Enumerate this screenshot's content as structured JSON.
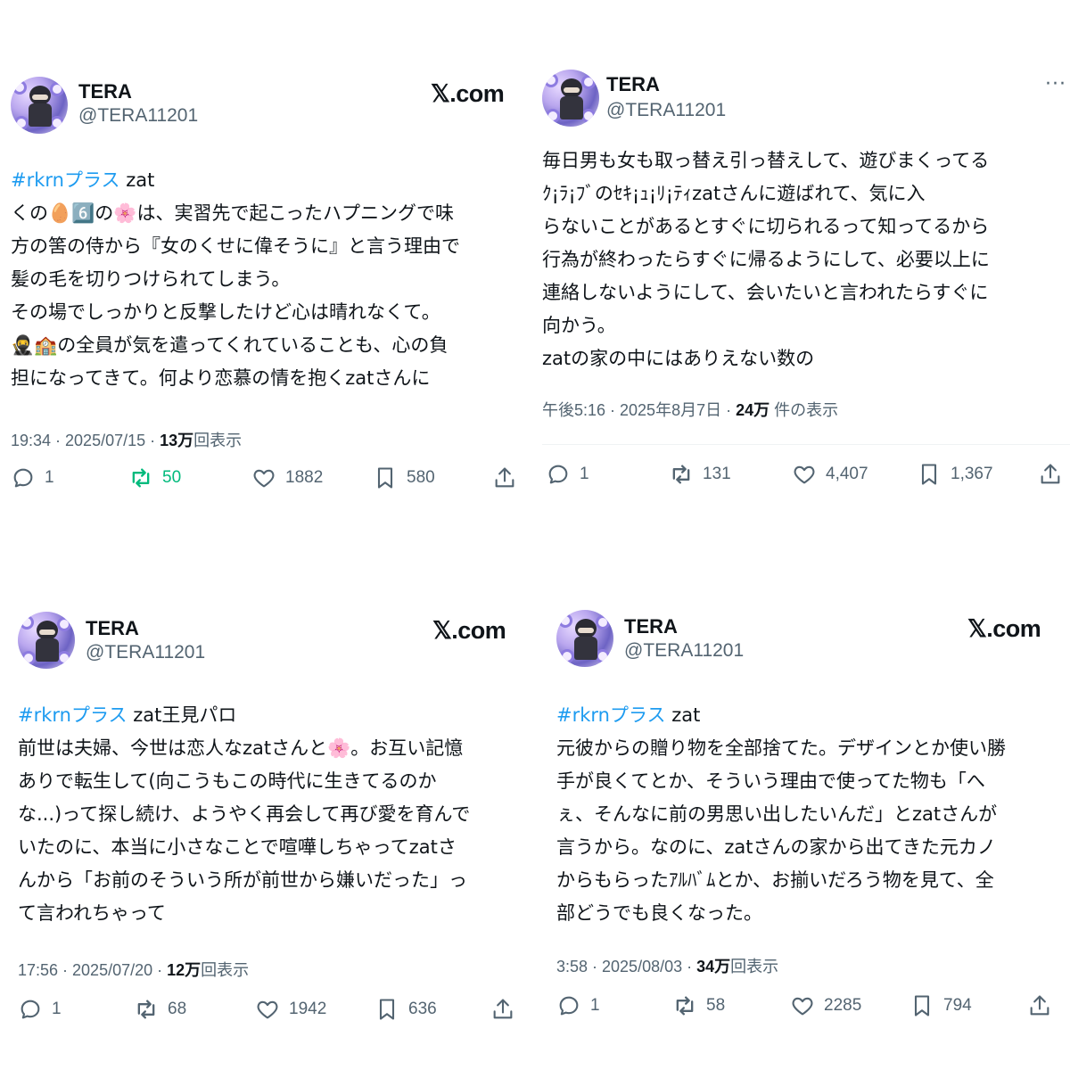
{
  "brand": {
    "x_logo": "𝕏.com",
    "retweet_active_color": "#00ba7c",
    "hashtag_color": "#1d9bf0"
  },
  "tweets": [
    {
      "name": "TERA",
      "handle": "@TERA11201",
      "hashtag": "#rkrnプラス",
      "tag_suffix": " zat",
      "lines": [
        "くの🥚6️⃣の🌸は、実習先で起こったハプニングで味",
        "方の筈の侍から『女のくせに偉そうに』と言う理由で",
        "髪の毛を切りつけられてしまう。",
        "その場でしっかりと反撃したけど心は晴れなくて。",
        "🥷🏫の全員が気を遣ってくれていることも、心の負",
        "担になってきて。何より恋慕の情を抱くzatさんに"
      ],
      "time": "19:34 · 2025/07/15 · ",
      "views": "13万",
      "views_suffix": "回表示",
      "replies": "1",
      "retweets": "50",
      "likes": "1882",
      "bookmarks": "580"
    },
    {
      "name": "TERA",
      "handle": "@TERA11201",
      "more": "···",
      "lines": [
        "毎日男も女も取っ替え引っ替えして、遊びまくってる",
        "ｸ¡ﾗ¡ﾌﾞのｾｷ¡ｭ¡ﾘ¡ﾃｨzatさんに遊ばれて、気に入",
        "らないことがあるとすぐに切られるって知ってるから",
        "行為が終わったらすぐに帰るようにして、必要以上に",
        "連絡しないようにして、会いたいと言われたらすぐに",
        "向かう。",
        "zatの家の中にはありえない数の"
      ],
      "time": "午後5:16 · 2025年8月7日 · ",
      "views": "24万",
      "views_suffix": " 件の表示",
      "replies": "1",
      "retweets": "131",
      "likes": "4,407",
      "bookmarks": "1,367"
    },
    {
      "name": "TERA",
      "handle": "@TERA11201",
      "hashtag": "#rkrnプラス",
      "tag_suffix": " zat王見パロ",
      "lines": [
        "前世は夫婦、今世は恋人なzatさんと🌸。お互い記憶",
        "ありで転生して(向こうもこの時代に生きてるのか",
        "な...)って探し続け、ようやく再会して再び愛を育んで",
        "いたのに、本当に小さなことで喧嘩しちゃってzatさ",
        "んから「お前のそういう所が前世から嫌いだった」っ",
        "て言われちゃって"
      ],
      "time": "17:56 · 2025/07/20 · ",
      "views": "12万",
      "views_suffix": "回表示",
      "replies": "1",
      "retweets": "68",
      "likes": "1942",
      "bookmarks": "636"
    },
    {
      "name": "TERA",
      "handle": "@TERA11201",
      "hashtag": "#rkrnプラス",
      "tag_suffix": " zat",
      "lines": [
        "元彼からの贈り物を全部捨てた。デザインとか使い勝",
        "手が良くてとか、そういう理由で使ってた物も「へ",
        "ぇ、そんなに前の男思い出したいんだ」とzatさんが",
        "言うから。なのに、zatさんの家から出てきた元カノ",
        "からもらったｱﾙﾊﾞﾑとか、お揃いだろう物を見て、全",
        "部どうでも良くなった。"
      ],
      "time": "3:58 · 2025/08/03 · ",
      "views": "34万",
      "views_suffix": "回表示",
      "replies": "1",
      "retweets": "58",
      "likes": "2285",
      "bookmarks": "794"
    }
  ],
  "icons": [
    "reply-icon",
    "retweet-icon",
    "like-icon",
    "bookmark-icon",
    "share-icon",
    "more-icon",
    "x-logo"
  ]
}
